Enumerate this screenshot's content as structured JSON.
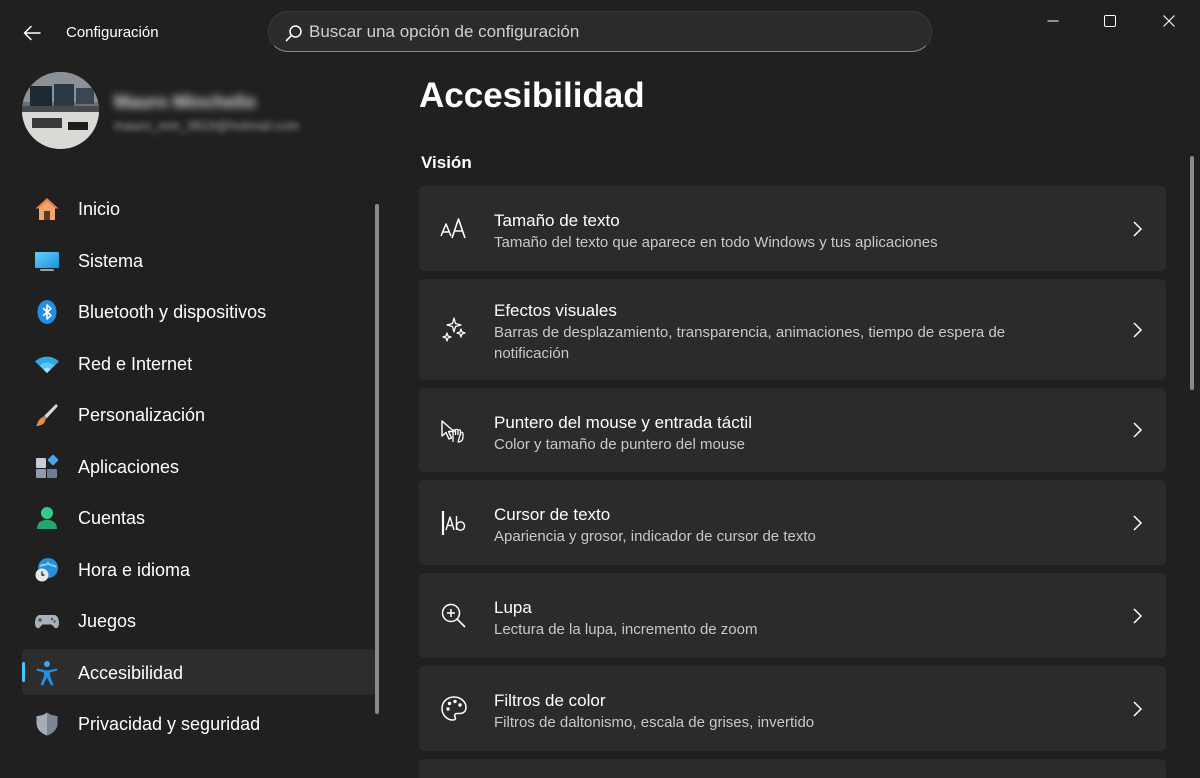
{
  "window": {
    "title": "Configuración",
    "search_placeholder": "Buscar una opción de configuración"
  },
  "profile": {
    "name": "Mauro Minchello",
    "email": "mauro_mm_3819@hotmail.com"
  },
  "sidebar": {
    "items": [
      {
        "label": "Inicio",
        "icon": "home-icon"
      },
      {
        "label": "Sistema",
        "icon": "system-icon"
      },
      {
        "label": "Bluetooth y dispositivos",
        "icon": "bluetooth-icon"
      },
      {
        "label": "Red e Internet",
        "icon": "wifi-icon"
      },
      {
        "label": "Personalización",
        "icon": "brush-icon"
      },
      {
        "label": "Aplicaciones",
        "icon": "apps-icon"
      },
      {
        "label": "Cuentas",
        "icon": "accounts-icon"
      },
      {
        "label": "Hora e idioma",
        "icon": "time-language-icon"
      },
      {
        "label": "Juegos",
        "icon": "gamepad-icon"
      },
      {
        "label": "Accesibilidad",
        "icon": "accessibility-icon",
        "active": true
      },
      {
        "label": "Privacidad y seguridad",
        "icon": "shield-icon"
      }
    ]
  },
  "main": {
    "title": "Accesibilidad",
    "section": "Visión",
    "cards": [
      {
        "title": "Tamaño de texto",
        "description": "Tamaño del texto que aparece en todo Windows y tus aplicaciones",
        "icon": "text-size-icon"
      },
      {
        "title": "Efectos visuales",
        "description": "Barras de desplazamiento, transparencia, animaciones, tiempo de espera de notificación",
        "icon": "visual-effects-icon"
      },
      {
        "title": "Puntero del mouse y entrada táctil",
        "description": "Color y tamaño de puntero del mouse",
        "icon": "mouse-pointer-icon"
      },
      {
        "title": "Cursor de texto",
        "description": "Apariencia y grosor, indicador de cursor de texto",
        "icon": "text-cursor-icon"
      },
      {
        "title": "Lupa",
        "description": "Lectura de la lupa, incremento de zoom",
        "icon": "magnifier-icon"
      },
      {
        "title": "Filtros de color",
        "description": "Filtros de daltonismo, escala de grises, invertido",
        "icon": "color-filters-icon"
      }
    ]
  },
  "colors": {
    "background": "#202020",
    "card": "#2b2b2b",
    "accent": "#4cc2ff"
  }
}
